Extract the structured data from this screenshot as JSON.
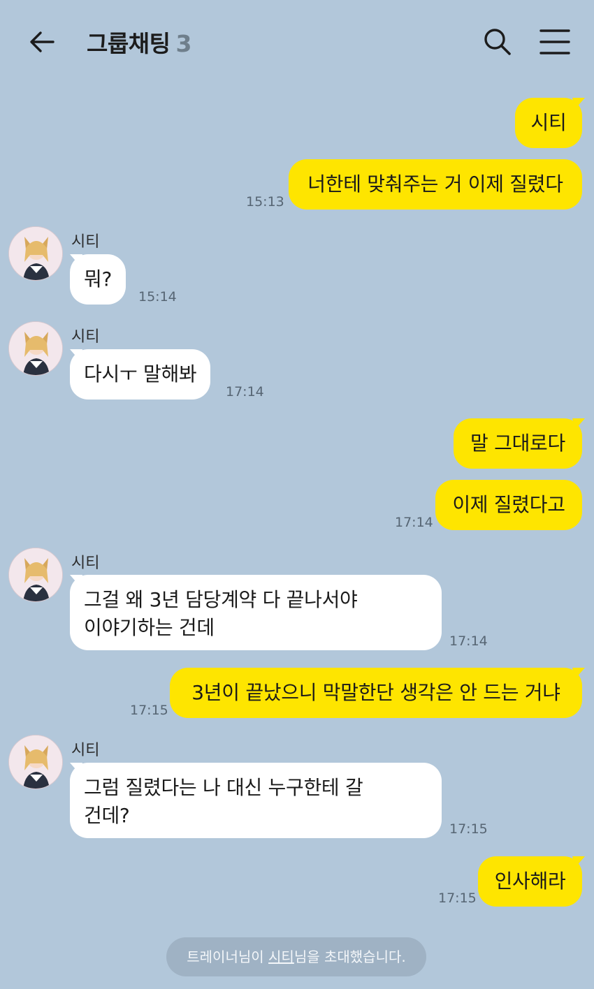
{
  "header": {
    "title": "그룹채팅",
    "member_count": "3"
  },
  "messages": [
    {
      "from": "me",
      "text": "시티",
      "time": ""
    },
    {
      "from": "me",
      "text": "너한테 맞춰주는 거 이제 질렸다",
      "time": "15:13"
    },
    {
      "from": "them",
      "sender": "시티",
      "text": "뭐?",
      "time": "15:14"
    },
    {
      "from": "them",
      "sender": "시티",
      "text": "다시ㅜ 말해봐",
      "time": "17:14"
    },
    {
      "from": "me",
      "text": "말 그대로다",
      "time": ""
    },
    {
      "from": "me",
      "text": "이제 질렸다고",
      "time": "17:14"
    },
    {
      "from": "them",
      "sender": "시티",
      "lines": [
        "그걸 왜 3년 담당계약 다 끝나서야",
        "이야기하는 건데"
      ],
      "time": "17:14"
    },
    {
      "from": "me",
      "text": "3년이 끝났으니 막말한단 생각은 안 드는 거냐",
      "time": "17:15"
    },
    {
      "from": "them",
      "sender": "시티",
      "lines": [
        "그럼 질렸다는 나 대신 누구한테 갈",
        "건데?"
      ],
      "time": "17:15"
    },
    {
      "from": "me",
      "text": "인사해라",
      "time": "17:15"
    }
  ],
  "system_notice": {
    "prefix": "트레이너님이 ",
    "link": "시티",
    "suffix": "님을 초대했습니다."
  },
  "colors": {
    "background": "#b2c7da",
    "my_bubble": "#fee500",
    "their_bubble": "#ffffff"
  },
  "icons": [
    "back-arrow-icon",
    "search-icon",
    "menu-icon",
    "avatar"
  ]
}
